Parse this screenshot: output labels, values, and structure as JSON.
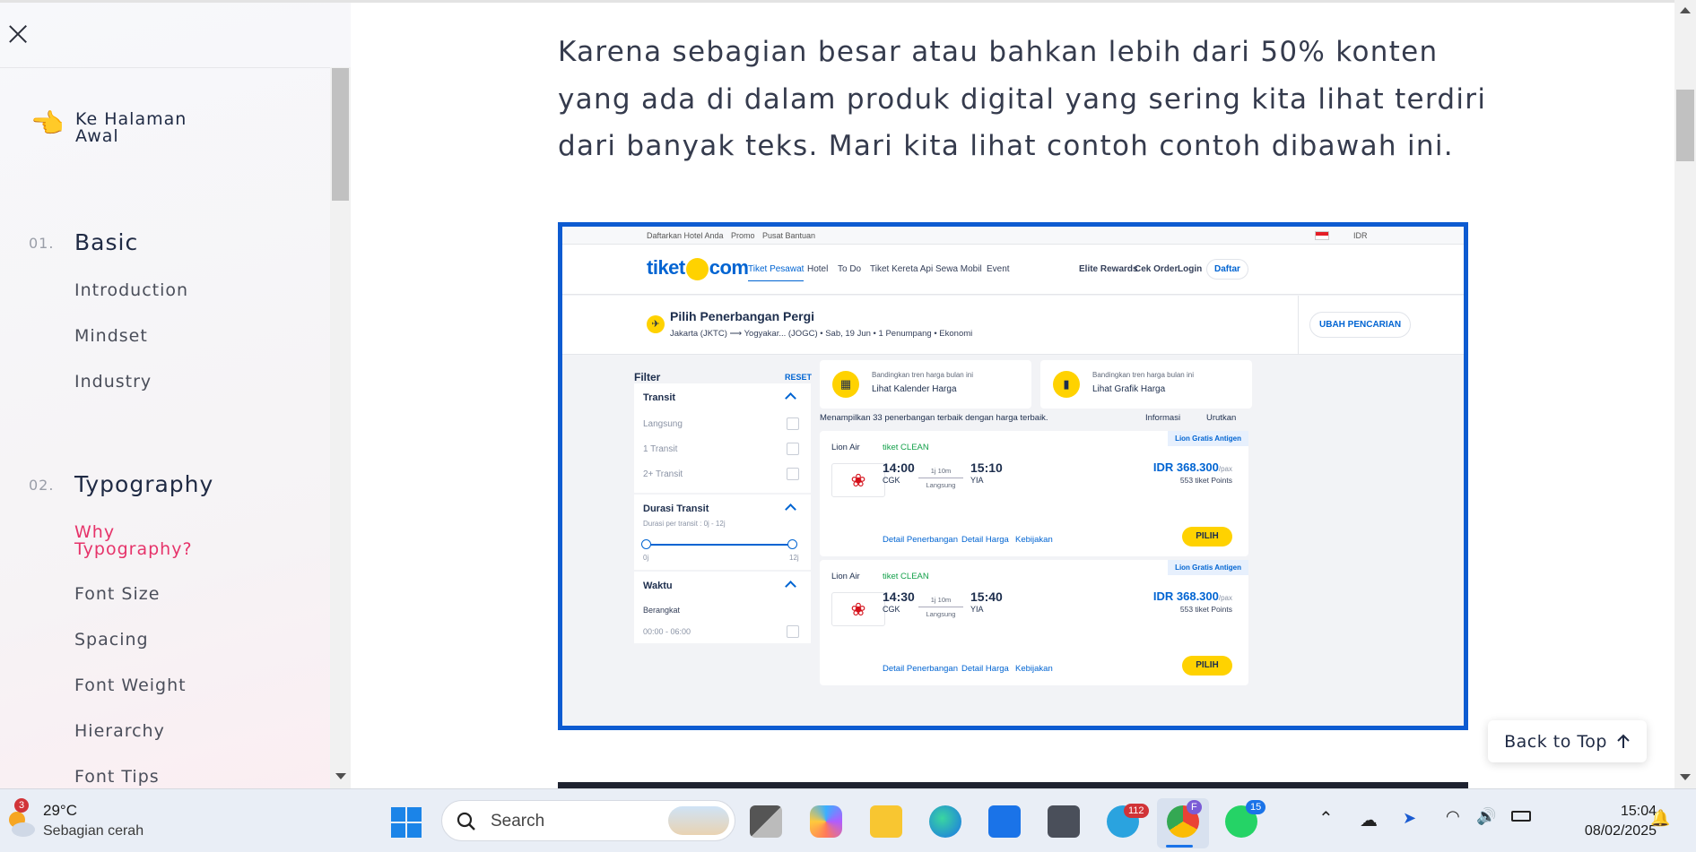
{
  "sidebar": {
    "home_icon": "👈",
    "home_label": "Ke Halaman Awal",
    "sections": [
      {
        "num": "01.",
        "title": "Basic",
        "items": [
          "Introduction",
          "Mindset",
          "Industry"
        ]
      },
      {
        "num": "02.",
        "title": "Typography",
        "items": [
          "Why Typography?",
          "Font Size",
          "Spacing",
          "Font Weight",
          "Hierarchy",
          "Font Tips"
        ]
      }
    ],
    "active_item": "Why Typography?"
  },
  "article": {
    "paragraph": "Karena sebagian besar atau bahkan lebih dari 50% konten yang ada di dalam produk digital yang sering kita lihat terdiri dari banyak teks. Mari kita lihat contoh contoh dibawah ini."
  },
  "screenshot": {
    "topbar": [
      "Daftarkan Hotel Anda",
      "Promo",
      "Pusat Bantuan"
    ],
    "currency": "IDR",
    "logo_left": "tiket",
    "logo_right": "com",
    "nav": [
      "Tiket Pesawat",
      "Hotel",
      "To Do",
      "Tiket Kereta Api",
      "Sewa Mobil",
      "Event"
    ],
    "right_nav": [
      "Elite Rewards",
      "Cek Order",
      "Login"
    ],
    "signup": "Daftar",
    "flight_title": "Pilih Penerbangan Pergi",
    "flight_sub": "Jakarta (JKTC) ⟶ Yogyakar... (JOGC)  •  Sab, 19 Jun  •  1 Penumpang  •  Ekonomi",
    "change_search": "UBAH PENCARIAN",
    "filter_title": "Filter",
    "filter_reset": "RESET",
    "transit_title": "Transit",
    "transit_options": [
      "Langsung",
      "1 Transit",
      "2+ Transit"
    ],
    "durasi_title": "Durasi Transit",
    "durasi_sub": "Durasi per transit : 0j - 12j",
    "range_min": "0j",
    "range_max": "12j",
    "waktu_title": "Waktu",
    "berangkat": "Berangkat",
    "time_option": "00:00 - 06:00",
    "compare1_small": "Bandingkan tren harga bulan ini",
    "compare1_big": "Lihat Kalender Harga",
    "compare2_small": "Bandingkan tren harga bulan ini",
    "compare2_big": "Lihat Grafik Harga",
    "showing": "Menampilkan 33 penerbangan terbaik dengan harga terbaik.",
    "info": "Informasi",
    "sort": "Urutkan",
    "flights": [
      {
        "badge": "Lion Gratis Antigen",
        "airline": "Lion Air",
        "clean": "tiket CLEAN",
        "dep": "14:00",
        "from": "CGK",
        "dur": "1j 10m",
        "type": "Langsung",
        "arr": "15:10",
        "to": "YIA",
        "price": "IDR 368.300",
        "per": "/pax",
        "points": "553 tiket Points",
        "links": [
          "Detail Penerbangan",
          "Detail Harga",
          "Kebijakan"
        ],
        "cta": "PILIH"
      },
      {
        "badge": "Lion Gratis Antigen",
        "airline": "Lion Air",
        "clean": "tiket CLEAN",
        "dep": "14:30",
        "from": "CGK",
        "dur": "1j 10m",
        "type": "Langsung",
        "arr": "15:40",
        "to": "YIA",
        "price": "IDR 368.300",
        "per": "/pax",
        "points": "553 tiket Points",
        "links": [
          "Detail Penerbangan",
          "Detail Harga",
          "Kebijakan"
        ],
        "cta": "PILIH"
      }
    ]
  },
  "back_to_top": "Back to Top",
  "taskbar": {
    "weather_badge": "3",
    "temp": "29°C",
    "condition": "Sebagian cerah",
    "search_placeholder": "Search",
    "telegram_badge": "112",
    "chrome_profile": "F",
    "whatsapp_badge": "15",
    "time": "15:04",
    "date": "08/02/2025"
  },
  "colors": {
    "accent": "#e6336a",
    "tiket_blue": "#0064d2",
    "tiket_yellow": "#ffd200"
  }
}
